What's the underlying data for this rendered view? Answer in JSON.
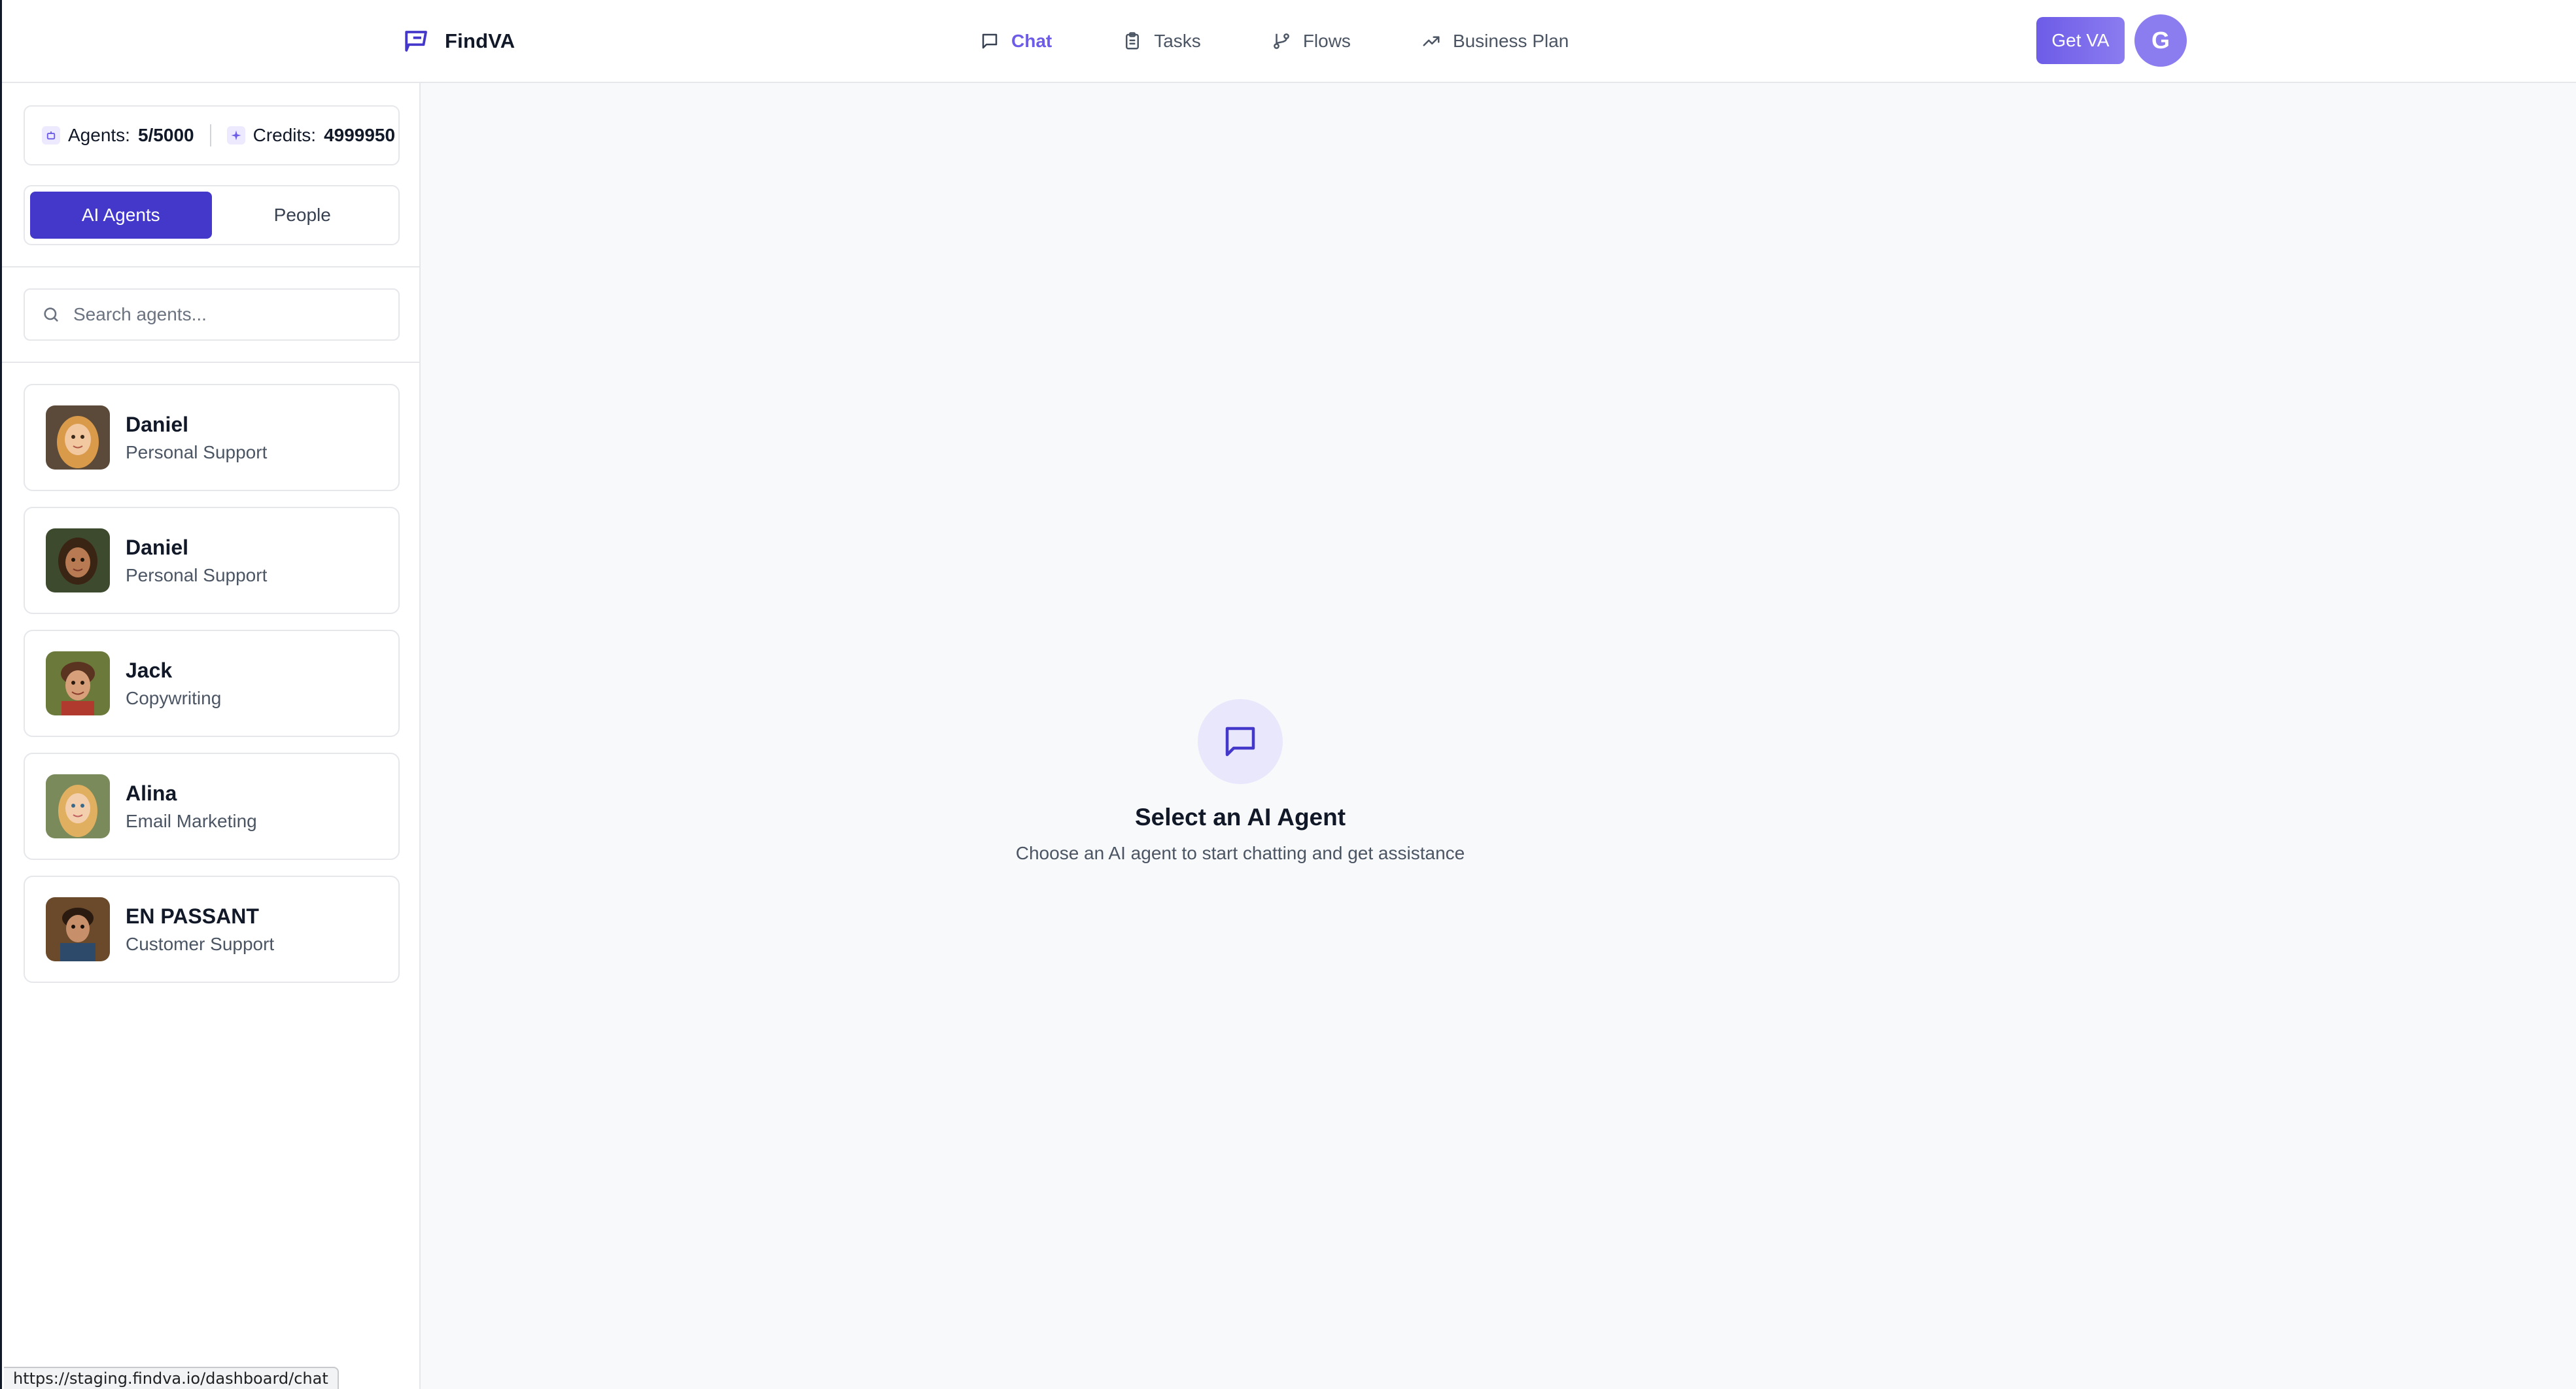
{
  "brand": {
    "name": "FindVA"
  },
  "nav": {
    "items": [
      {
        "label": "Chat",
        "icon": "message-square-icon",
        "active": true
      },
      {
        "label": "Tasks",
        "icon": "clipboard-icon",
        "active": false
      },
      {
        "label": "Flows",
        "icon": "git-branch-icon",
        "active": false
      },
      {
        "label": "Business Plan",
        "icon": "trending-up-icon",
        "active": false
      }
    ]
  },
  "header": {
    "get_va_label": "Get VA",
    "user_initial": "G"
  },
  "sidebar": {
    "stats": {
      "agents_label": "Agents:",
      "agents_value": "5/5000",
      "credits_label": "Credits:",
      "credits_value": "4999950"
    },
    "toggle": {
      "ai_agents": "AI Agents",
      "people": "People",
      "selected": "AI Agents"
    },
    "search": {
      "placeholder": "Search agents..."
    },
    "agents": [
      {
        "name": "Daniel",
        "role": "Personal Support"
      },
      {
        "name": "Daniel",
        "role": "Personal Support"
      },
      {
        "name": "Jack",
        "role": "Copywriting"
      },
      {
        "name": "Alina",
        "role": "Email Marketing"
      },
      {
        "name": "EN PASSANT",
        "role": "Customer Support"
      }
    ]
  },
  "main": {
    "empty_title": "Select an AI Agent",
    "empty_subtitle": "Choose an AI agent to start chatting and get assistance"
  },
  "status_bar": {
    "url": "https://staging.findva.io/dashboard/chat"
  },
  "colors": {
    "accent": "#4338ca",
    "brand_purple": "#6d5ce7",
    "avatar": "#8b7cf0"
  }
}
